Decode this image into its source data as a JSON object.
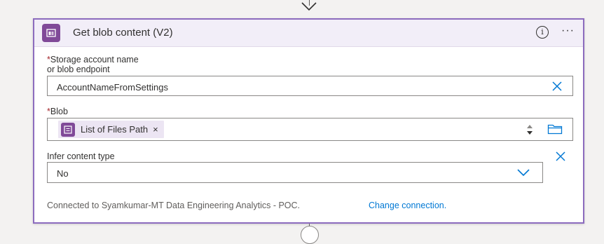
{
  "action": {
    "title": "Get blob content (V2)",
    "info_glyph": "i",
    "more_glyph": "···"
  },
  "fields": {
    "storage_account": {
      "required_mark": "*",
      "label_line1": "Storage account name",
      "label_line2": "or blob endpoint",
      "value": "AccountNameFromSettings"
    },
    "blob": {
      "required_mark": "*",
      "label": "Blob",
      "token_label": "List of Files Path",
      "token_remove": "×"
    },
    "infer_content_type": {
      "label": "Infer content type",
      "value": "No"
    }
  },
  "connection": {
    "text": "Connected to Syamkumar-MT Data Engineering Analytics - POC.",
    "change_link": "Change connection."
  },
  "colors": {
    "accent_purple": "#804998",
    "border_purple": "#8c6cbe",
    "header_bg": "#f2eef8",
    "link_blue": "#0078d4",
    "required_red": "#a4262c"
  },
  "icons": {
    "header": "blob-storage-icon",
    "token": "expression-icon",
    "info": "info-icon",
    "more": "more-options-icon",
    "clear": "close-icon",
    "folder": "folder-icon",
    "dropdown": "chevron-down-icon"
  }
}
